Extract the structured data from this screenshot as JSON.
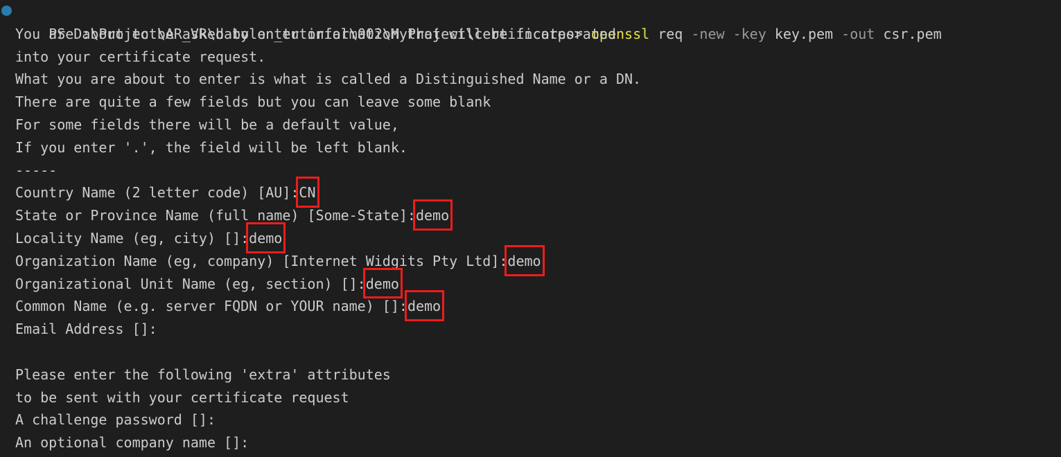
{
  "terminal": {
    "shell": "PowerShell",
    "background_color": "#1e1e1e",
    "foreground_color": "#cccccc",
    "accent_command_color": "#e7e34a",
    "flag_color": "#9a9a9a",
    "highlight_box_color": "#ee1c1c",
    "run_indicator_color": "#2a7cae",
    "prompt": {
      "prefix": "PS ",
      "path": "D:\\Project\\AR_VR\\babylon_tutorial\\002\\MyProject\\certificates",
      "suffix": "> ",
      "command_name": "openssl",
      "command_tokens": [
        {
          "text": "openssl",
          "type": "command"
        },
        {
          "text": "req",
          "type": "arg"
        },
        {
          "text": "-new",
          "type": "flag"
        },
        {
          "text": "-key",
          "type": "flag"
        },
        {
          "text": "key.pem",
          "type": "arg"
        },
        {
          "text": "-out",
          "type": "flag"
        },
        {
          "text": "csr.pem",
          "type": "arg"
        }
      ]
    },
    "intro_lines": [
      "You are about to be asked to enter information that will be incorporated",
      "into your certificate request.",
      "What you are about to enter is what is called a Distinguished Name or a DN.",
      "There are quite a few fields but you can leave some blank",
      "For some fields there will be a default value,",
      "If you enter '.', the field will be left blank.",
      "-----"
    ],
    "dn_fields": [
      {
        "label": "Country Name (2 letter code) [AU]:",
        "value": "CN",
        "highlighted": true
      },
      {
        "label": "State or Province Name (full name) [Some-State]:",
        "value": "demo",
        "highlighted": true
      },
      {
        "label": "Locality Name (eg, city) []:",
        "value": "demo",
        "highlighted": true
      },
      {
        "label": "Organization Name (eg, company) [Internet Widgits Pty Ltd]:",
        "value": "demo",
        "highlighted": true
      },
      {
        "label": "Organizational Unit Name (eg, section) []:",
        "value": "demo",
        "highlighted": true
      },
      {
        "label": "Common Name (e.g. server FQDN or YOUR name) []:",
        "value": "demo",
        "highlighted": true
      },
      {
        "label": "Email Address []:",
        "value": "",
        "highlighted": false
      }
    ],
    "extra_intro_lines": [
      "Please enter the following 'extra' attributes",
      "to be sent with your certificate request"
    ],
    "extra_fields": [
      {
        "label": "A challenge password []:",
        "value": "",
        "highlighted": false
      },
      {
        "label": "An optional company name []:",
        "value": "",
        "highlighted": false
      }
    ]
  }
}
